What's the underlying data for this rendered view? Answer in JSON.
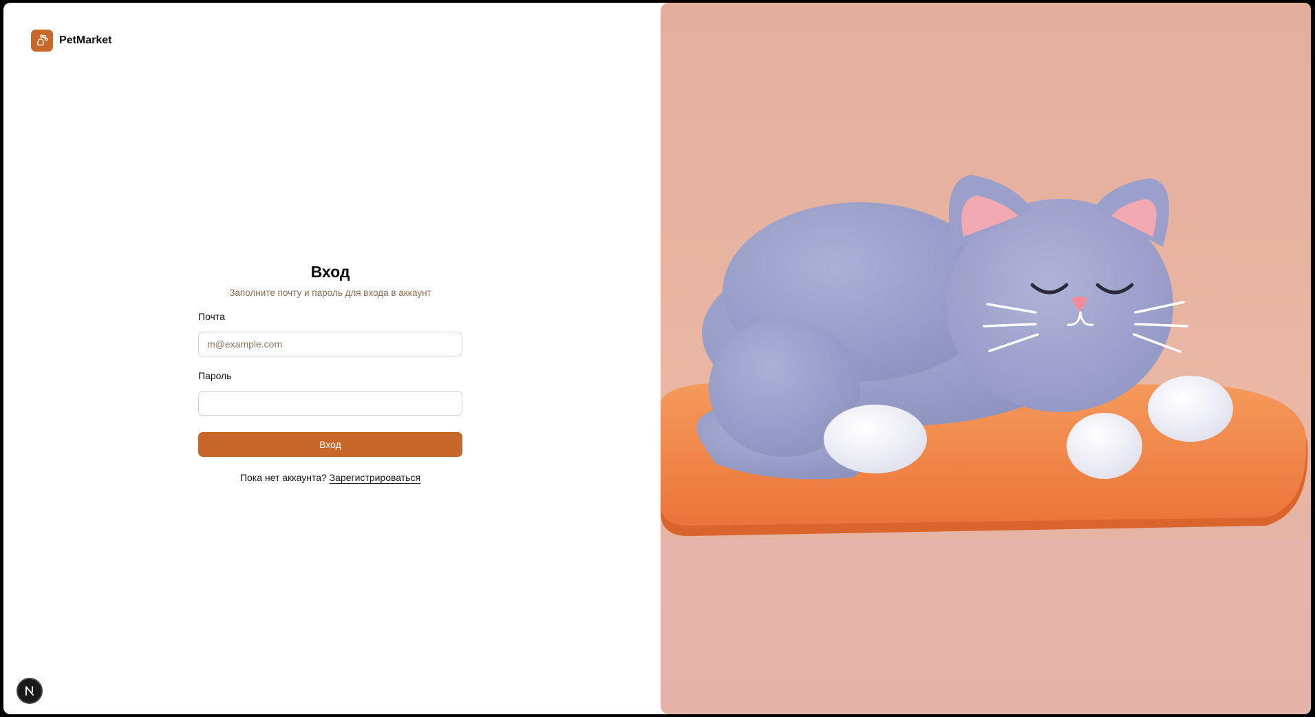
{
  "brand": {
    "name": "PetMarket",
    "logo_icon": "paw-icon",
    "accent": "#c8672a"
  },
  "login": {
    "title": "Вход",
    "subtitle": "Заполните почту и пароль для входа в аккаунт",
    "email_label": "Почта",
    "email_placeholder": "m@example.com",
    "email_value": "",
    "password_label": "Пароль",
    "password_value": "",
    "submit_label": "Вход",
    "signup_prompt": "Пока нет аккаунта? ",
    "signup_link": "Зарегистрироваться"
  },
  "illustration": {
    "subject": "sleeping-cat-on-cushion-illustration",
    "background": "#e6b2a0",
    "cushion_color": "#f08a4a",
    "cat_color": "#9aa0c8"
  },
  "dev_badge": {
    "icon": "nextjs-icon",
    "letter": "N"
  }
}
